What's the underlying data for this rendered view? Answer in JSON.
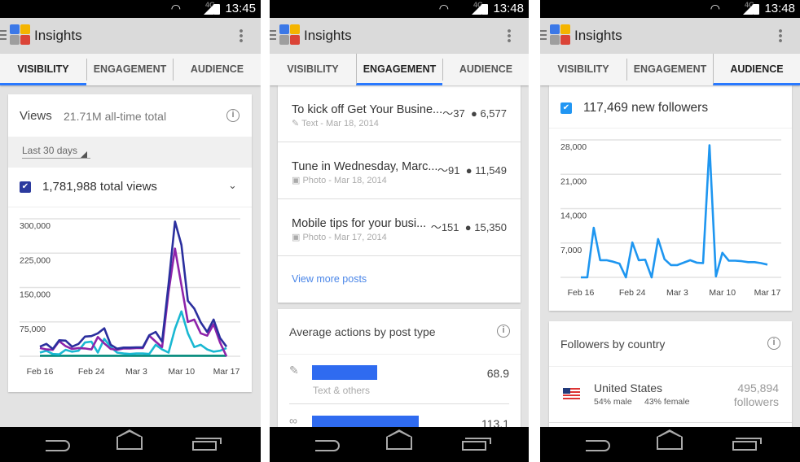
{
  "app": {
    "title": "Insights",
    "logo_colors": [
      "#3b78e7",
      "#f4b400",
      "#9e9e9e",
      "#db4437"
    ]
  },
  "tabs": [
    "VISIBILITY",
    "ENGAGEMENT",
    "AUDIENCE"
  ],
  "colors": {
    "accent": "#2979ff",
    "bar": "#2f6bf0",
    "link": "#4a86e8"
  },
  "phones": [
    {
      "status": {
        "time": "13:45",
        "network": "4G"
      },
      "active_tab": "VISIBILITY",
      "views": {
        "label": "Views",
        "total": "21.71M all-time total"
      },
      "range": "Last 30 days",
      "metric": "1,781,988 total views"
    },
    {
      "status": {
        "time": "13:48",
        "network": "4G"
      },
      "active_tab": "ENGAGEMENT",
      "posts": [
        {
          "title": "To kick off Get Your Busine...",
          "icon": "pencil-icon",
          "meta": "Text - Mar 18, 2014",
          "shares": "37",
          "views": "6,577"
        },
        {
          "title": "Tune in Wednesday, Marc...",
          "icon": "camera-icon",
          "meta": "Photo - Mar 18, 2014",
          "shares": "91",
          "views": "11,549"
        },
        {
          "title": "Mobile tips for your busi...",
          "icon": "camera-icon",
          "meta": "Photo - Mar 17, 2014",
          "shares": "151",
          "views": "15,350"
        }
      ],
      "view_more": "View more posts",
      "avg_title": "Average actions by post type",
      "avg_rows": [
        {
          "icon": "pencil-icon",
          "label": "Text & others",
          "value": 68.9,
          "display": "68.9"
        },
        {
          "icon": "link-icon",
          "label": "",
          "value": 113.1,
          "display": "113.1"
        }
      ]
    },
    {
      "status": {
        "time": "13:48",
        "network": "4G"
      },
      "active_tab": "AUDIENCE",
      "metric": "117,469 new followers",
      "country_title": "Followers by country",
      "countries": [
        {
          "name": "United States",
          "male": "54% male",
          "female": "43% female",
          "count": "495,894",
          "unit": "followers"
        }
      ]
    }
  ],
  "chart_data": [
    {
      "type": "line",
      "x_tick_labels": [
        "Feb 16",
        "Feb 24",
        "Mar 3",
        "Mar 10",
        "Mar 17"
      ],
      "y_tick_labels": [
        "300,000",
        "225,000",
        "150,000",
        "75,000"
      ],
      "ylim": [
        0,
        300000
      ],
      "grid": true,
      "series": [
        {
          "color": "#2b2f9e",
          "values": [
            21000,
            27000,
            16000,
            35000,
            34000,
            21000,
            27000,
            43000,
            44000,
            50000,
            61000,
            25000,
            16500,
            19000,
            19000,
            19500,
            19500,
            46000,
            53000,
            32000,
            157000,
            294000,
            243000,
            121000,
            104000,
            74000,
            53000,
            80000,
            40000,
            21000
          ]
        },
        {
          "color": "#8e24aa",
          "values": [
            18000,
            15000,
            14000,
            33000,
            22000,
            16000,
            18000,
            17000,
            15000,
            42000,
            28000,
            16000,
            14000,
            17000,
            17000,
            18000,
            18000,
            45000,
            32000,
            20000,
            140000,
            235000,
            155000,
            75000,
            80000,
            50000,
            45000,
            70000,
            30000,
            0
          ]
        },
        {
          "color": "#1ab8d2",
          "values": [
            8000,
            12000,
            5000,
            4000,
            14000,
            10000,
            12000,
            30000,
            32000,
            8000,
            38000,
            20000,
            8000,
            6000,
            5000,
            6000,
            6000,
            5000,
            25000,
            15000,
            8000,
            60000,
            98000,
            50000,
            20000,
            25000,
            15000,
            10000,
            12000,
            18000
          ]
        },
        {
          "color": "#00897b",
          "values": [
            1000,
            1000,
            1000,
            1000,
            1000,
            1000,
            1000,
            1000,
            1000,
            1000,
            1000,
            1000,
            1000,
            1000,
            1000,
            1000,
            1000,
            1000,
            1000,
            1000,
            1000,
            1000,
            1000,
            1000,
            1000,
            1000,
            1000,
            1000,
            1000,
            1000
          ]
        }
      ]
    },
    {
      "type": "line",
      "x_tick_labels": [
        "Feb 16",
        "Feb 24",
        "Mar 3",
        "Mar 10",
        "Mar 17"
      ],
      "y_tick_labels": [
        "28,000",
        "21,000",
        "14,000",
        "7,000"
      ],
      "ylim": [
        0,
        28000
      ],
      "grid": true,
      "series": [
        {
          "color": "#1e96f0",
          "values": [
            0,
            0,
            10100,
            3500,
            3500,
            3200,
            2800,
            0,
            7100,
            3500,
            3600,
            0,
            7800,
            3700,
            2500,
            2500,
            3000,
            3500,
            3000,
            2900,
            26900,
            200,
            5000,
            3400,
            3400,
            3300,
            3100,
            3100,
            2900,
            2600
          ]
        }
      ]
    }
  ]
}
